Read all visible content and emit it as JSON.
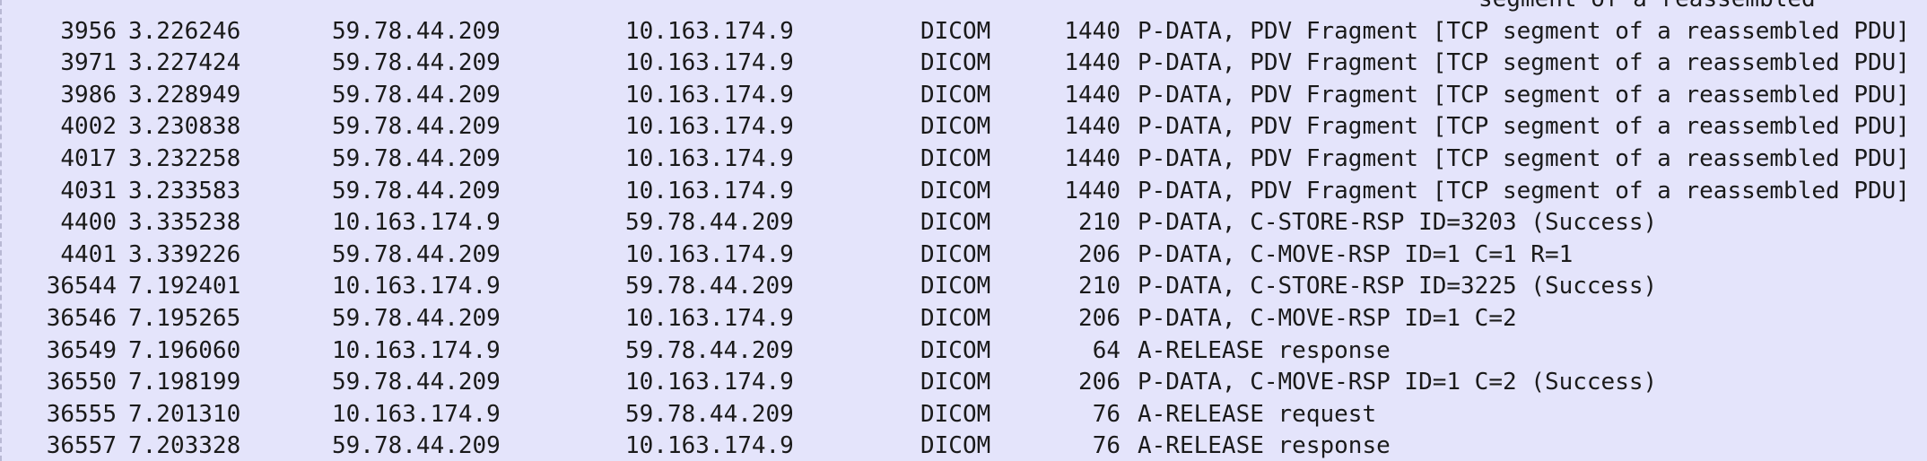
{
  "packets": {
    "rows": [
      {
        "no": "",
        "time": "",
        "src": "",
        "dst": "",
        "proto": "",
        "len": "",
        "info": "segment of a reassembled"
      },
      {
        "no": "3956",
        "time": "3.226246",
        "src": "59.78.44.209",
        "dst": "10.163.174.9",
        "proto": "DICOM",
        "len": "1440",
        "info": "P-DATA, PDV Fragment [TCP segment of a reassembled PDU]"
      },
      {
        "no": "3971",
        "time": "3.227424",
        "src": "59.78.44.209",
        "dst": "10.163.174.9",
        "proto": "DICOM",
        "len": "1440",
        "info": "P-DATA, PDV Fragment [TCP segment of a reassembled PDU]"
      },
      {
        "no": "3986",
        "time": "3.228949",
        "src": "59.78.44.209",
        "dst": "10.163.174.9",
        "proto": "DICOM",
        "len": "1440",
        "info": "P-DATA, PDV Fragment [TCP segment of a reassembled PDU]"
      },
      {
        "no": "4002",
        "time": "3.230838",
        "src": "59.78.44.209",
        "dst": "10.163.174.9",
        "proto": "DICOM",
        "len": "1440",
        "info": "P-DATA, PDV Fragment [TCP segment of a reassembled PDU]"
      },
      {
        "no": "4017",
        "time": "3.232258",
        "src": "59.78.44.209",
        "dst": "10.163.174.9",
        "proto": "DICOM",
        "len": "1440",
        "info": "P-DATA, PDV Fragment [TCP segment of a reassembled PDU]"
      },
      {
        "no": "4031",
        "time": "3.233583",
        "src": "59.78.44.209",
        "dst": "10.163.174.9",
        "proto": "DICOM",
        "len": "1440",
        "info": "P-DATA, PDV Fragment [TCP segment of a reassembled PDU]"
      },
      {
        "no": "4400",
        "time": "3.335238",
        "src": "10.163.174.9",
        "dst": "59.78.44.209",
        "proto": "DICOM",
        "len": "210",
        "info": "P-DATA, C-STORE-RSP ID=3203 (Success)"
      },
      {
        "no": "4401",
        "time": "3.339226",
        "src": "59.78.44.209",
        "dst": "10.163.174.9",
        "proto": "DICOM",
        "len": "206",
        "info": "P-DATA, C-MOVE-RSP ID=1 C=1 R=1"
      },
      {
        "no": "36544",
        "time": "7.192401",
        "src": "10.163.174.9",
        "dst": "59.78.44.209",
        "proto": "DICOM",
        "len": "210",
        "info": "P-DATA, C-STORE-RSP ID=3225 (Success)"
      },
      {
        "no": "36546",
        "time": "7.195265",
        "src": "59.78.44.209",
        "dst": "10.163.174.9",
        "proto": "DICOM",
        "len": "206",
        "info": "P-DATA, C-MOVE-RSP ID=1 C=2"
      },
      {
        "no": "36549",
        "time": "7.196060",
        "src": "10.163.174.9",
        "dst": "59.78.44.209",
        "proto": "DICOM",
        "len": "64",
        "info": "A-RELEASE response"
      },
      {
        "no": "36550",
        "time": "7.198199",
        "src": "59.78.44.209",
        "dst": "10.163.174.9",
        "proto": "DICOM",
        "len": "206",
        "info": "P-DATA, C-MOVE-RSP ID=1 C=2 (Success)"
      },
      {
        "no": "36555",
        "time": "7.201310",
        "src": "10.163.174.9",
        "dst": "59.78.44.209",
        "proto": "DICOM",
        "len": "76",
        "info": "A-RELEASE request"
      },
      {
        "no": "36557",
        "time": "7.203328",
        "src": "59.78.44.209",
        "dst": "10.163.174.9",
        "proto": "DICOM",
        "len": "76",
        "info": "A-RELEASE response"
      }
    ]
  }
}
